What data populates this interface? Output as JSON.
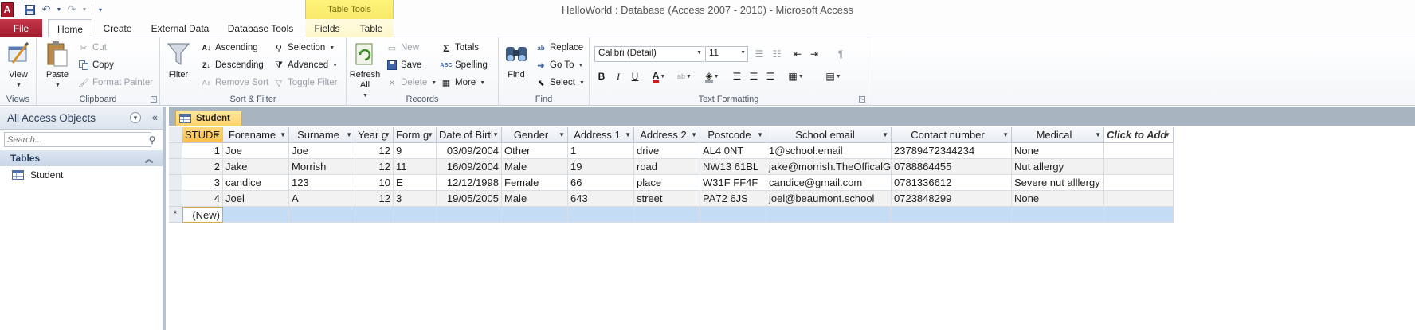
{
  "window": {
    "title": "HelloWorld : Database (Access 2007 - 2010)  -  Microsoft Access",
    "app_icon_letter": "A",
    "context_group": "Table Tools"
  },
  "tabs": [
    {
      "label": "File"
    },
    {
      "label": "Home"
    },
    {
      "label": "Create"
    },
    {
      "label": "External Data"
    },
    {
      "label": "Database Tools"
    },
    {
      "label": "Fields"
    },
    {
      "label": "Table"
    }
  ],
  "ribbon": {
    "views": {
      "label": "Views",
      "view": "View"
    },
    "clipboard": {
      "label": "Clipboard",
      "paste": "Paste",
      "cut": "Cut",
      "copy": "Copy",
      "format_painter": "Format Painter"
    },
    "sort_filter": {
      "label": "Sort & Filter",
      "filter": "Filter",
      "ascending": "Ascending",
      "descending": "Descending",
      "remove_sort": "Remove Sort",
      "selection": "Selection",
      "advanced": "Advanced",
      "toggle_filter": "Toggle Filter"
    },
    "records": {
      "label": "Records",
      "refresh": "Refresh",
      "refresh_all": "All",
      "new": "New",
      "save": "Save",
      "delete": "Delete",
      "totals": "Totals",
      "spelling": "Spelling",
      "more": "More"
    },
    "find": {
      "label": "Find",
      "find": "Find",
      "replace": "Replace",
      "goto": "Go To",
      "select": "Select"
    },
    "text_formatting": {
      "label": "Text Formatting",
      "font_name": "Calibri (Detail)",
      "font_size": "11",
      "bold": "B",
      "italic": "I",
      "underline": "U"
    }
  },
  "nav": {
    "header": "All Access Objects",
    "search_placeholder": "Search...",
    "group": "Tables",
    "items": [
      {
        "label": "Student"
      }
    ]
  },
  "document": {
    "tab_label": "Student",
    "columns": [
      "STUDE",
      "Forename",
      "Surname",
      "Year g",
      "Form g",
      "Date of Birtl",
      "Gender",
      "Address 1",
      "Address 2",
      "Postcode",
      "School email",
      "Contact number",
      "Medical",
      "Click to Add"
    ],
    "rows": [
      [
        "1",
        "Joe",
        "Joe",
        "12",
        "9",
        "03/09/2004",
        "Other",
        "1",
        "drive",
        "AL4  0NT",
        "1@school.email",
        "23789472344234",
        "None",
        ""
      ],
      [
        "2",
        "Jake",
        "Morrish",
        "12",
        "11",
        "16/09/2004",
        "Male",
        "19",
        "road",
        "NW13 61BL",
        "jake@morrish.TheOfficalGo",
        "0788864455",
        "Nut allergy",
        ""
      ],
      [
        "3",
        "candice",
        "123",
        "10",
        "E",
        "12/12/1998",
        "Female",
        "66",
        "place",
        "W31F FF4F",
        "candice@gmail.com",
        "0781336612",
        "Severe nut alllergy",
        ""
      ],
      [
        "4",
        "Joel",
        "A",
        "12",
        "3",
        "19/05/2005",
        "Male",
        "643",
        "street",
        "PA72 6JS",
        "joel@beaumont.school",
        "0723848299",
        "None",
        ""
      ]
    ],
    "new_row_label": "(New)",
    "new_row_marker": "*"
  },
  "colors": {
    "file_tab": "#a01a2f",
    "context_tab": "#fff37a",
    "selected_header": "#fbbf4a",
    "new_row": "#c5dcf5",
    "doc_tab": "#ffd36b"
  }
}
